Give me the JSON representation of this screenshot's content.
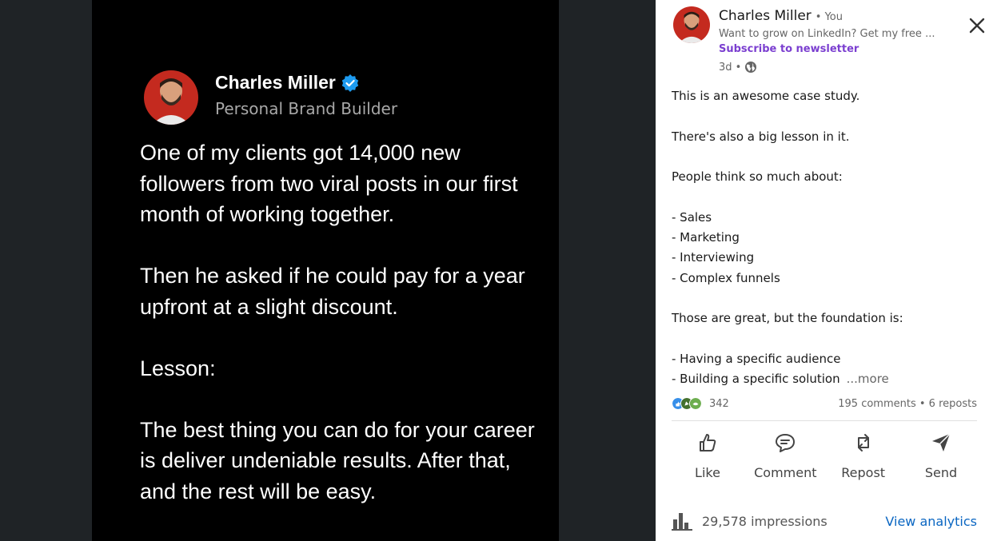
{
  "post_image": {
    "author_name": "Charles Miller",
    "author_title": "Personal Brand Builder",
    "paragraphs": [
      "One of my clients got 14,000 new followers from two viral posts in our first month of working together.",
      "Then he asked if he could pay for a year upfront at a slight discount.",
      "Lesson:",
      "The best thing you can do for your career is deliver undeniable results. After that, and the rest will be easy."
    ]
  },
  "panel": {
    "author_name": "Charles Miller",
    "author_you": "• You",
    "headline": "Want to grow on LinkedIn? Get my free ...",
    "subscribe": "Subscribe to newsletter",
    "time": "3d •",
    "lines": [
      "This is an awesome case study.",
      "",
      "There's also a big lesson in it.",
      "",
      "People think so much about:",
      "",
      "- Sales",
      "- Marketing",
      "- Interviewing",
      "- Complex funnels",
      "",
      "Those are great, but the foundation is:",
      "",
      "- Having a specific audience",
      "- Building a specific solution"
    ],
    "more": "...more",
    "reaction_count": "342",
    "comments_reposts": "195 comments • 6 reposts",
    "actions": {
      "like": "Like",
      "comment": "Comment",
      "repost": "Repost",
      "send": "Send"
    },
    "impressions": "29,578 impressions",
    "view_analytics": "View analytics"
  },
  "colors": {
    "link": "#0a66c2",
    "subscribe": "#7b3fd0",
    "verified": "#1d9bf0"
  }
}
